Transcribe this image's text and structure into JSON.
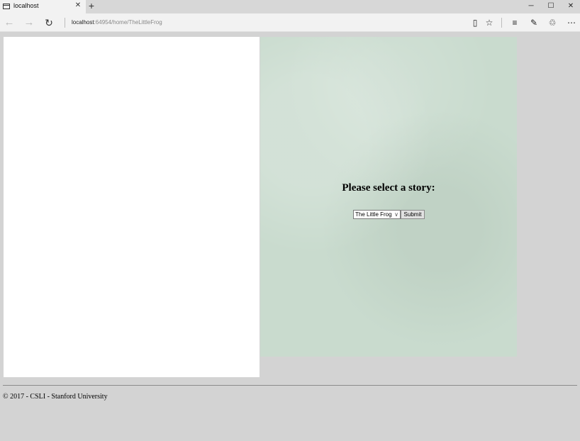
{
  "browser": {
    "tab_title": "localhost",
    "tab_close": "✕",
    "new_tab": "+",
    "minimize": "─",
    "maximize": "☐",
    "close": "✕",
    "back": "←",
    "forward": "→",
    "refresh": "↻",
    "url_host": "localhost",
    "url_path": ":64954/home/TheLittleFrog",
    "toolbar_icons": {
      "reading_view": "▯",
      "favorite": "☆",
      "hub": "≡",
      "web_note": "✎",
      "share": "♲",
      "more": "⋯"
    }
  },
  "page": {
    "heading": "Please select a story:",
    "select_value": "The Little Frog",
    "select_chevron": "∨",
    "submit_label": "Submit",
    "footer": "© 2017 - CSLI - Stanford University"
  }
}
